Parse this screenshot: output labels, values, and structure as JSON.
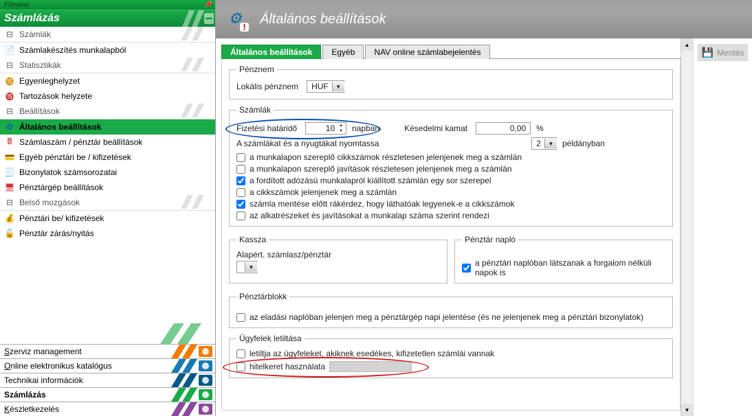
{
  "sidebar": {
    "menuLabel": "Főmenü",
    "currentCategory": "Számlázás",
    "groups": [
      {
        "kind": "group",
        "label": "Számlák",
        "icon": "⊟"
      },
      {
        "kind": "item",
        "label": "Számlakészítés munkalapból",
        "icon": "📄",
        "clr": "#c33"
      },
      {
        "kind": "group",
        "label": "Statisztikák",
        "icon": "⊟"
      },
      {
        "kind": "item",
        "label": "Egyenleghelyzet",
        "icon": "⓯",
        "clr": "#d88b00"
      },
      {
        "kind": "item",
        "label": "Tartozások helyzete",
        "icon": "⓯",
        "clr": "#c33"
      },
      {
        "kind": "group",
        "label": "Beállítások",
        "icon": "⊟"
      },
      {
        "kind": "item",
        "label": "Általános beállítások",
        "icon": "⚙",
        "active": true,
        "clr": "#0d6aa8"
      },
      {
        "kind": "item",
        "label": "Számlaszám / pénztár beállítások",
        "icon": "🖩",
        "clr": "#c33"
      },
      {
        "kind": "item",
        "label": "Egyéb pénztári be / kifizetések",
        "icon": "💳",
        "clr": "#0a7a30"
      },
      {
        "kind": "item",
        "label": "Bizonylatok számsorozatai",
        "icon": "🧾",
        "clr": "#6b4a9b"
      },
      {
        "kind": "item",
        "label": "Pénztárgép beállítások",
        "icon": "🖥",
        "clr": "#c33"
      },
      {
        "kind": "group",
        "label": "Belső mozgások",
        "icon": "⊟"
      },
      {
        "kind": "item",
        "label": "Pénztári be/ kifizetések",
        "icon": "💰",
        "clr": "#0a7a30"
      },
      {
        "kind": "item",
        "label": "Pénztár zárás/nyitás",
        "icon": "🔓",
        "clr": "#c33"
      }
    ],
    "categories": [
      {
        "label": "Szerviz management",
        "color": "#f07b00",
        "mnemonic": 0
      },
      {
        "label": "Online elektronikus katalógus",
        "color": "#177bb4",
        "mnemonic": 0
      },
      {
        "label": "Technikai információk",
        "color": "#005a84",
        "mnemonic": -1
      },
      {
        "label": "Számlázás",
        "color": "#1aaa48",
        "bold": true,
        "mnemonic": -1
      },
      {
        "label": "Készletkezelés",
        "color": "#8a4a9b",
        "mnemonic": 0
      }
    ]
  },
  "header": {
    "title": "Általános beállítások"
  },
  "tabs": [
    {
      "label": "Általános beállítások",
      "active": true
    },
    {
      "label": "Egyéb"
    },
    {
      "label": "NAV online számlabejelentés"
    }
  ],
  "form": {
    "penznem": {
      "legend": "Pénznem",
      "localLabel": "Lokális pénznem",
      "localValue": "HUF"
    },
    "szamlak": {
      "legend": "Számlák",
      "fizLabel": "Fizetési határidő",
      "fizValue": "10",
      "fizUnit": "napban",
      "kesLabel": "Késedelmi kamat",
      "kesValue": "0,00",
      "kesUnit": "%",
      "printLabel": "A számlákat és a nyugtákat nyomtassa",
      "printCopies": "2",
      "printUnit": "példányban",
      "checks": [
        {
          "c": false,
          "t": "a munkalapon szereplő cikkszámok részletesen jelenjenek meg a számlán"
        },
        {
          "c": false,
          "t": "a munkalapon szereplő javítások részletesen jelenjenek meg a számlán"
        },
        {
          "c": true,
          "t": "a fordított adózású munkalapról kiállított számlán egy sor szerepel"
        },
        {
          "c": false,
          "t": "a cikkszámok jelenjenek meg a számlán"
        },
        {
          "c": true,
          "t": "számla mentése előtt rákérdez, hogy láthatóak legyenek-e a cikkszámok"
        },
        {
          "c": false,
          "t": "az alkatrészeket és javításokat a munkalap száma szerint rendezi"
        }
      ]
    },
    "kassza": {
      "legend": "Kassza",
      "label": "Alapért. számlasz/pénztár",
      "value": ""
    },
    "naplo": {
      "legend": "Pénztár napló",
      "chk": {
        "c": true,
        "t": "a pénztári naplóban látszanak a forgalom nélküli napok is"
      }
    },
    "blokk": {
      "legend": "Pénztárblokk",
      "chk": {
        "c": false,
        "t": "az eladási naplóban jelenjen meg a pénztárgép napi jelentése (és ne jelenjenek meg a pénztári bizonylatok)"
      }
    },
    "ugyfel": {
      "legend": "Ügyfelek letiltása",
      "chk1": {
        "c": false,
        "t": "letiltja az ügyfeleket, akiknek esedékes, kifizetetlen számlái vannak"
      },
      "chk2": {
        "c": false,
        "t": "hitelkeret használata"
      }
    }
  },
  "actions": {
    "saveLabel": "Mentés"
  }
}
